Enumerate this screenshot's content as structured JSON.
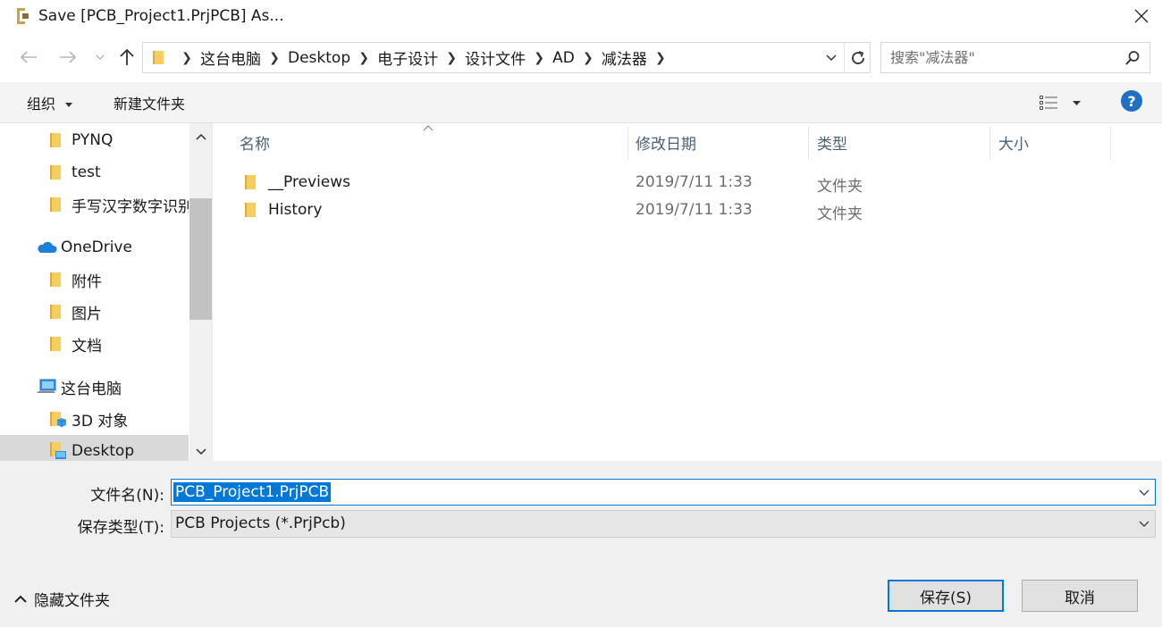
{
  "window": {
    "title": "Save [PCB_Project1.PrjPCB] As..."
  },
  "address_bar": {
    "crumbs": [
      "这台电脑",
      "Desktop",
      "电子设计",
      "设计文件",
      "AD",
      "减法器"
    ]
  },
  "search": {
    "placeholder": "搜索\"减法器\""
  },
  "toolbar": {
    "organize_label": "组织",
    "new_folder_label": "新建文件夹",
    "help_label": "?"
  },
  "nav": {
    "items": [
      {
        "label": "PYNQ",
        "icon": "folder-icon"
      },
      {
        "label": "test",
        "icon": "folder-icon"
      },
      {
        "label": "手写汉字数字识别",
        "icon": "folder-icon"
      },
      {
        "label": "OneDrive",
        "icon": "cloud-icon"
      },
      {
        "label": "附件",
        "icon": "folder-icon"
      },
      {
        "label": "图片",
        "icon": "folder-icon"
      },
      {
        "label": "文档",
        "icon": "folder-icon"
      },
      {
        "label": "这台电脑",
        "icon": "computer-icon"
      },
      {
        "label": "3D 对象",
        "icon": "3d-objects-icon"
      },
      {
        "label": "Desktop",
        "icon": "desktop-folder-icon",
        "selected": true
      }
    ]
  },
  "file_list": {
    "columns": {
      "name": "名称",
      "modified": "修改日期",
      "type": "类型",
      "size": "大小"
    },
    "rows": [
      {
        "name": "__Previews",
        "modified": "2019/7/11 1:33",
        "type": "文件夹"
      },
      {
        "name": "History",
        "modified": "2019/7/11 1:33",
        "type": "文件夹"
      }
    ]
  },
  "form": {
    "filename_label": "文件名(N):",
    "filename_value": "PCB_Project1.PrjPCB",
    "filetype_label": "保存类型(T):",
    "filetype_value": "PCB Projects (*.PrjPcb)",
    "hide_folders_label": "隐藏文件夹",
    "save_label": "保存(S)",
    "cancel_label": "取消"
  },
  "colors": {
    "accent": "#0078d7",
    "folder": "#f3c35a",
    "help": "#1f6fc5"
  }
}
